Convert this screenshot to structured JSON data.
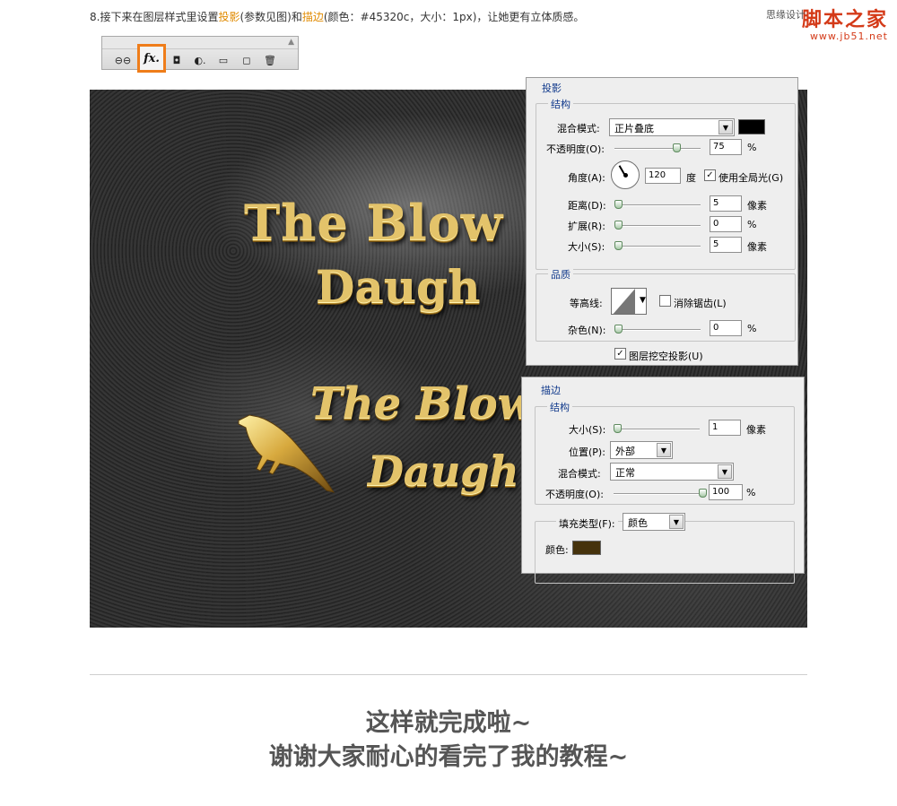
{
  "instruction": {
    "prefix": "8.接下来在图层样式里设置",
    "link1": "投影",
    "mid1": "(参数见图)和",
    "link2": "描边",
    "suffix": "(颜色：#45320c，大小：1px)，让她更有立体质感。"
  },
  "watermark": {
    "small": "思缘设计",
    "logo": "脚本之家",
    "url": "www.jb51.net"
  },
  "toolbar": {
    "items": [
      {
        "icon": "link-icon",
        "glyph": "⊖⊖"
      },
      {
        "icon": "fx-icon",
        "label": "fx."
      },
      {
        "icon": "mask-icon",
        "glyph": "◘"
      },
      {
        "icon": "adjustment-icon",
        "glyph": "◐."
      },
      {
        "icon": "group-icon",
        "glyph": "▭"
      },
      {
        "icon": "new-layer-icon",
        "glyph": "◻"
      },
      {
        "icon": "trash-icon",
        "glyph": "🗑"
      }
    ]
  },
  "artwork": {
    "line1": "The Blow",
    "line2": "Daugh",
    "line3": "The Blow",
    "line4": "Daugh"
  },
  "drop_shadow": {
    "title": "投影",
    "structure_title": "结构",
    "blend_label": "混合模式:",
    "blend_value": "正片叠底",
    "blend_color": "#000000",
    "opacity_label": "不透明度(O):",
    "opacity_value": "75",
    "opacity_fraction": 0.75,
    "angle_label": "角度(A):",
    "angle_value": "120",
    "angle_unit": "度",
    "global_light_label": "使用全局光(G)",
    "global_light_checked": true,
    "distance_label": "距离(D):",
    "distance_value": "5",
    "spread_label": "扩展(R):",
    "spread_value": "0",
    "size_label": "大小(S):",
    "size_value": "5",
    "pixel_unit": "像素",
    "percent_unit": "%",
    "quality_title": "品质",
    "contour_label": "等高线:",
    "antialias_label": "消除锯齿(L)",
    "antialias_checked": false,
    "noise_label": "杂色(N):",
    "noise_value": "0",
    "knockout_label": "图层挖空投影(U)",
    "knockout_checked": true
  },
  "stroke": {
    "title": "描边",
    "structure_title": "结构",
    "size_label": "大小(S):",
    "size_value": "1",
    "pixel_unit": "像素",
    "position_label": "位置(P):",
    "position_value": "外部",
    "blend_label": "混合模式:",
    "blend_value": "正常",
    "opacity_label": "不透明度(O):",
    "opacity_value": "100",
    "opacity_fraction": 1.0,
    "percent_unit": "%",
    "fill_type_label": "填充类型(F):",
    "fill_type_value": "颜色",
    "color_label": "颜色:",
    "color_value": "#45320c"
  },
  "closing": {
    "line1": "这样就完成啦~",
    "line2": "谢谢大家耐心的看完了我的教程~"
  }
}
